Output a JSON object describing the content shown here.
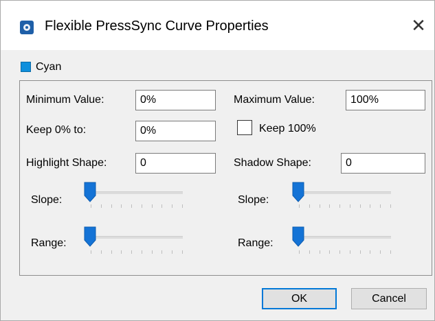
{
  "window": {
    "title": "Flexible PressSync Curve Properties"
  },
  "channel": {
    "name": "Cyan",
    "swatch_color": "#0f8fdc"
  },
  "fields": {
    "minimum_value": {
      "label": "Minimum Value:",
      "value": "0%"
    },
    "maximum_value": {
      "label": "Maximum Value:",
      "value": "100%"
    },
    "keep_0": {
      "label": "Keep 0% to:",
      "value": "0%"
    },
    "keep_100": {
      "label": "Keep 100%",
      "checked": false
    },
    "highlight_shape": {
      "label": "Highlight Shape:",
      "value": "0"
    },
    "shadow_shape": {
      "label": "Shadow Shape:",
      "value": "0"
    }
  },
  "highlight_sliders": {
    "slope": {
      "label": "Slope:",
      "level": 0
    },
    "range": {
      "label": "Range:",
      "level": 0
    }
  },
  "shadow_sliders": {
    "slope": {
      "label": "Slope:",
      "level": 0
    },
    "range": {
      "label": "Range:",
      "level": 0
    }
  },
  "buttons": {
    "ok": "OK",
    "cancel": "Cancel"
  },
  "colors": {
    "accent": "#0078d7",
    "thumb": "#1473d6"
  }
}
